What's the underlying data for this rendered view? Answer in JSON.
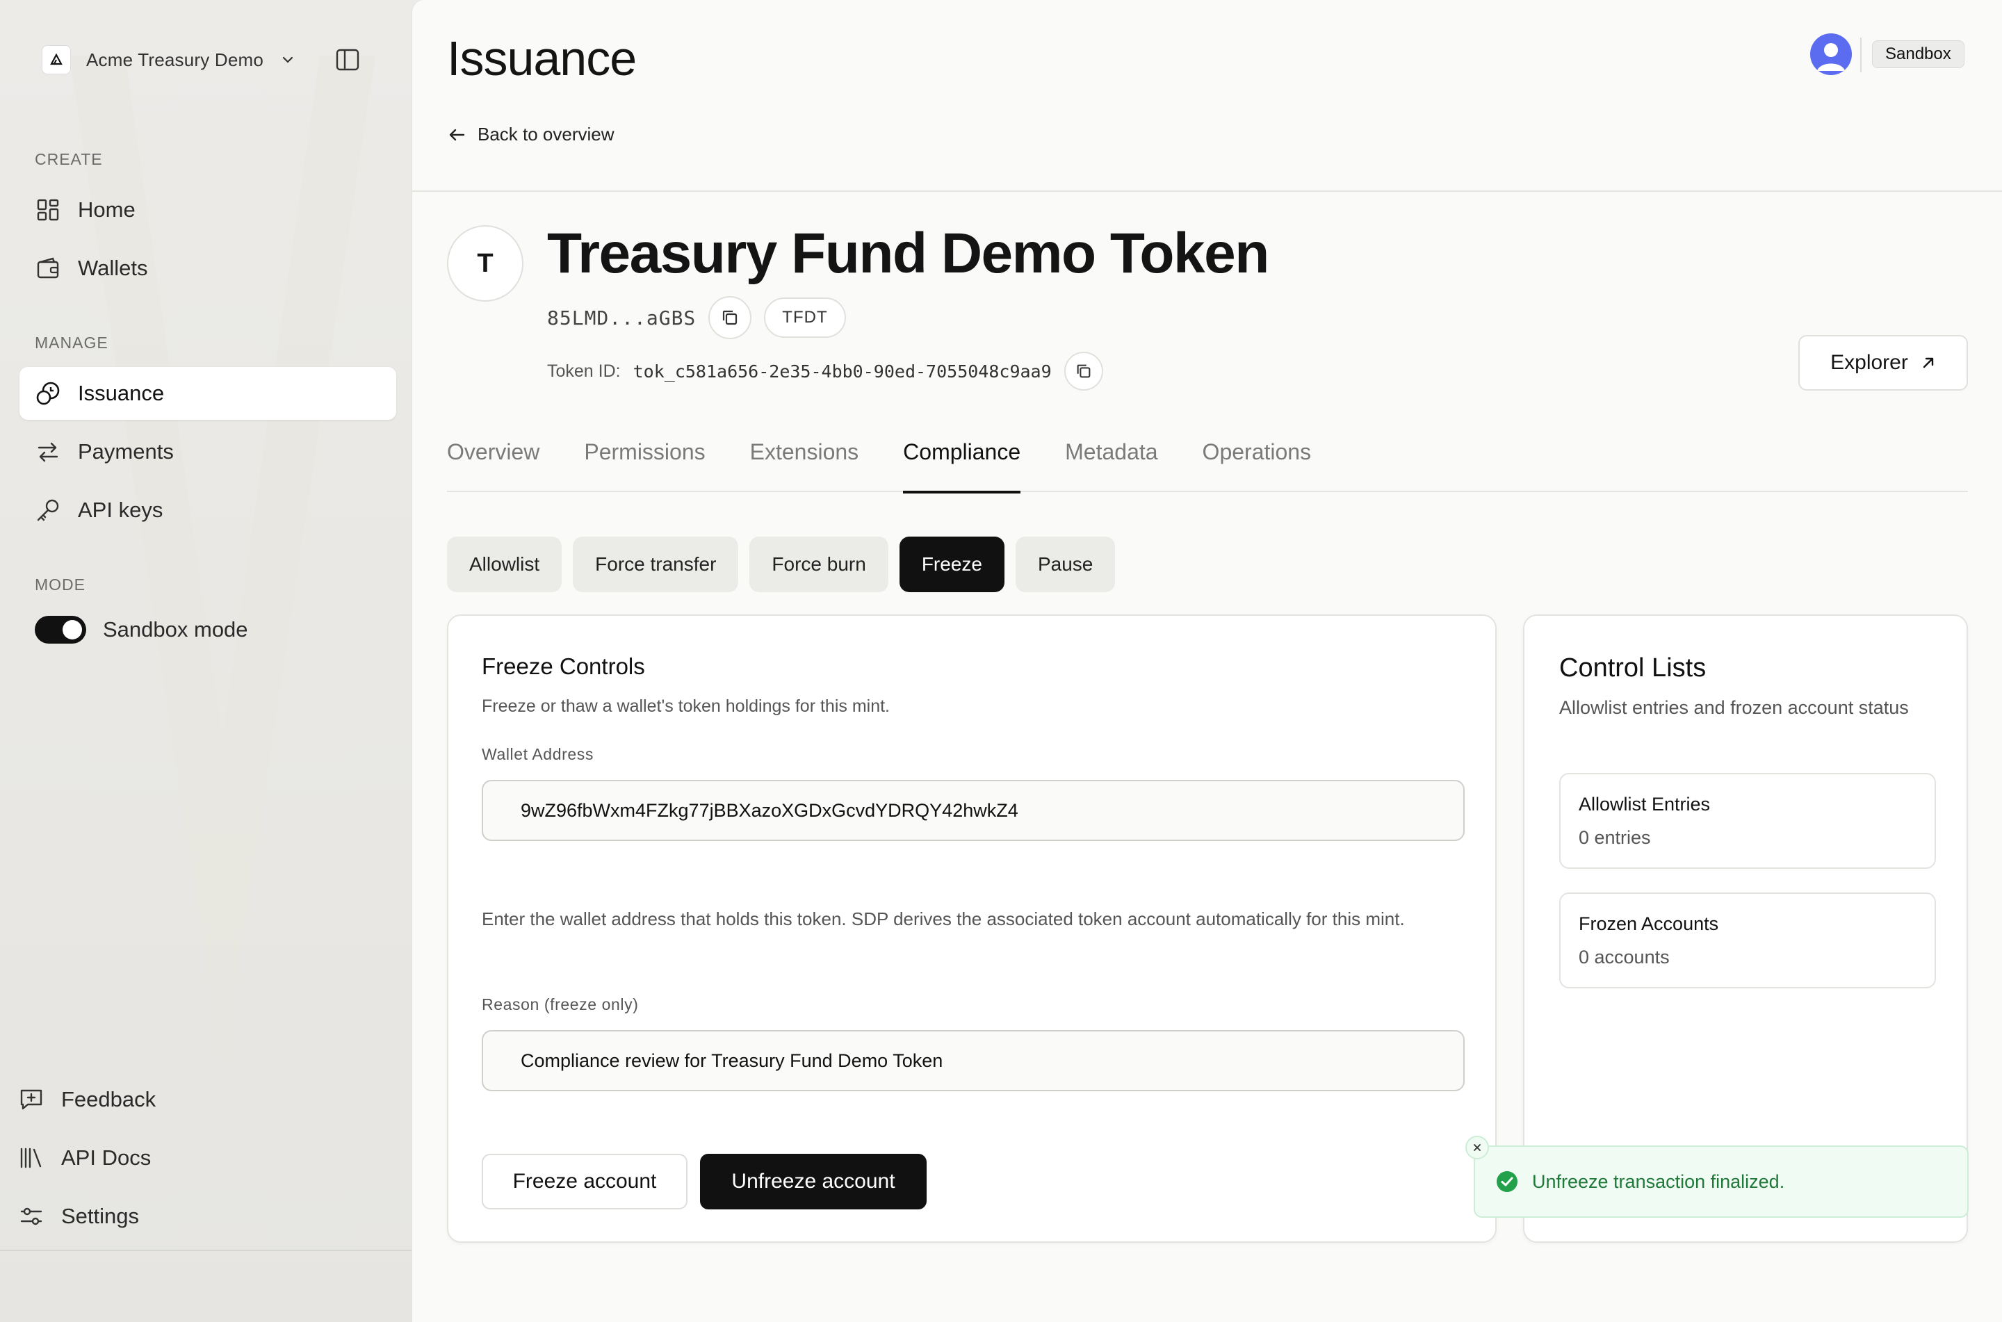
{
  "sidebar": {
    "org_name": "Acme Treasury Demo",
    "sections": {
      "create": "CREATE",
      "manage": "MANAGE",
      "mode": "MODE"
    },
    "items": {
      "home": "Home",
      "wallets": "Wallets",
      "issuance": "Issuance",
      "payments": "Payments",
      "api_keys": "API keys"
    },
    "sandbox_toggle": {
      "label": "Sandbox mode",
      "on": true
    },
    "bottom": {
      "feedback": "Feedback",
      "api_docs": "API Docs",
      "settings": "Settings"
    }
  },
  "header": {
    "title": "Issuance",
    "back_link": "Back to overview",
    "environment_badge": "Sandbox"
  },
  "token": {
    "avatar_letter": "T",
    "name": "Treasury Fund Demo Token",
    "short_address": "85LMD...aGBS",
    "symbol": "TFDT",
    "token_id_label": "Token ID:",
    "token_id": "tok_c581a656-2e35-4bb0-90ed-7055048c9aa9",
    "explorer_label": "Explorer"
  },
  "tabs": [
    "Overview",
    "Permissions",
    "Extensions",
    "Compliance",
    "Metadata",
    "Operations"
  ],
  "active_tab": "Compliance",
  "subtabs": [
    "Allowlist",
    "Force transfer",
    "Force burn",
    "Freeze",
    "Pause"
  ],
  "active_subtab": "Freeze",
  "freeze_controls": {
    "title": "Freeze Controls",
    "description": "Freeze or thaw a wallet's token holdings for this mint.",
    "wallet_label": "Wallet Address",
    "wallet_value": "9wZ96fbWxm4FZkg77jBBXazoXGDxGcvdYDRQY42hwkZ4",
    "help_text": "Enter the wallet address that holds this token. SDP derives the associated token account automatically for this mint.",
    "reason_label": "Reason (freeze only)",
    "reason_value": "Compliance review for Treasury Fund Demo Token",
    "freeze_button": "Freeze account",
    "unfreeze_button": "Unfreeze account"
  },
  "control_lists": {
    "title": "Control Lists",
    "description": "Allowlist entries and frozen account status",
    "allowlist": {
      "title": "Allowlist Entries",
      "value": "0 entries"
    },
    "frozen": {
      "title": "Frozen Accounts",
      "value": "0 accounts"
    }
  },
  "toast": {
    "message": "Unfreeze transaction finalized.",
    "status": "success",
    "color": "#1f7a3a"
  },
  "colors": {
    "accent": "#111111",
    "avatar": "#5b6cf0",
    "success": "#22a14a"
  }
}
